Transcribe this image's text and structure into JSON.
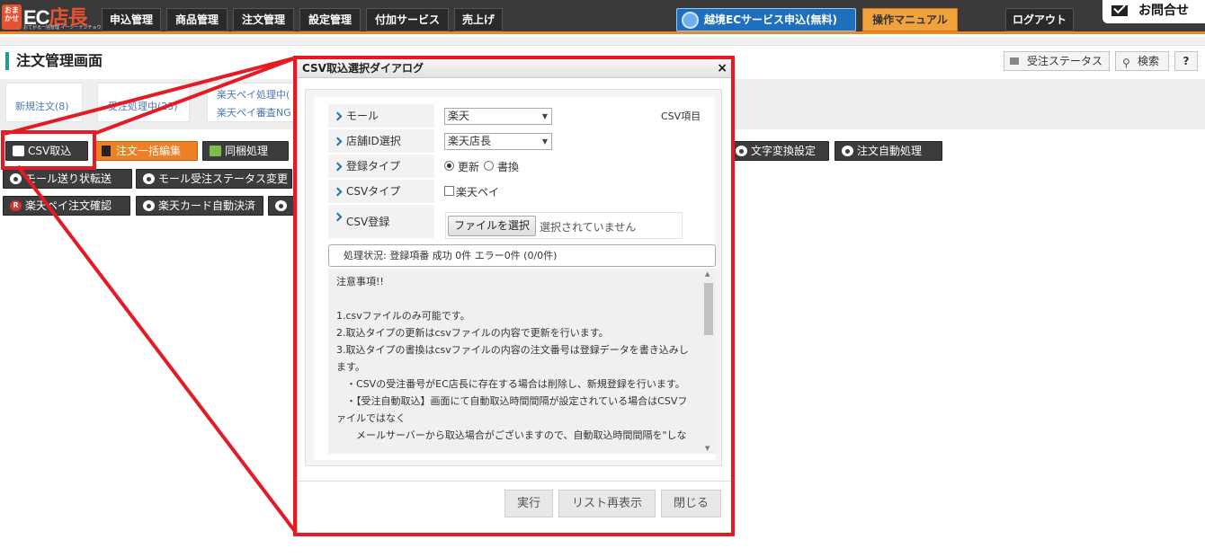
{
  "header": {
    "logo": {
      "badge": "おまかせ",
      "text_a": "EC",
      "text_b": "店長",
      "tagline": "おてがる一括管理 イーシーテンチョウ"
    },
    "nav": [
      "申込管理",
      "商品管理",
      "注文管理",
      "設定管理",
      "付加サービス",
      "売上げ"
    ],
    "cross_border": "越境ECサービス申込(無料)",
    "manual": "操作マニュアル",
    "logout": "ログアウト",
    "inquiry": "お問合せ"
  },
  "page": {
    "title": "注文管理画面",
    "order_status_button": "受注ステータス",
    "search_button": "検索",
    "help_button": "?"
  },
  "tabs": {
    "new_orders": "新規注文(8)",
    "processing": "受注処理中(23)",
    "rakuten_pay_processing": "楽天ペイ処理中(",
    "rakuten_pay_ng": "楽天ペイ審査NG"
  },
  "actions": {
    "csv_import": "CSV取込",
    "bulk_edit": "注文一括編集",
    "bundle": "同梱処理",
    "text_convert": "文字変換設定",
    "auto_process": "注文自動処理",
    "mall_transfer": "モール送り状転送",
    "mall_status_change": "モール受注ステータス変更",
    "rakuten_pay_confirm": "楽天ペイ注文確認",
    "rakuten_card_settle": "楽天カード自動決済",
    "rakuten_badge": "R"
  },
  "dialog": {
    "title": "CSV取込選択ダイアログ",
    "close": "×",
    "csv_items_label": "CSV項目",
    "mall_label": "モール",
    "mall_value": "楽天",
    "shop_label": "店舗ID選択",
    "shop_value": "楽天店長",
    "reg_type_label": "登録タイプ",
    "reg_opt_update": "更新",
    "reg_opt_write": "書換",
    "csv_type_label": "CSVタイプ",
    "csv_type_option": "楽天ペイ",
    "csv_reg_label": "CSV登録",
    "file_button": "ファイルを選択",
    "file_none": "選択されていません",
    "status": "処理状況: 登録項番 成功 0件 エラー0件 (0/0件)",
    "notes": [
      "注意事項!!",
      "",
      "1.csvファイルのみ可能です。",
      "2.取込タイプの更新はcsvファイルの内容で更新を行います。",
      "3.取込タイプの書換はcsvファイルの内容の注文番号は登録データを書き込みし",
      "ます。",
      "　・CSVの受注番号がEC店長に存在する場合は削除し、新規登録を行います。",
      "　・【受注自動取込】画面にて自動取込時間間隔が設定されている場合はCSVフ",
      "ァイルではなく",
      "　　メールサーバーから取込場合がございますので、自動取込時間間隔を\"しな"
    ],
    "buttons": {
      "execute": "実行",
      "refresh": "リスト再表示",
      "close": "閉じる"
    }
  },
  "colors": {
    "highlight": "#e41b24",
    "accent_orange": "#f07f24",
    "nav_bg": "#3a3a3a"
  }
}
